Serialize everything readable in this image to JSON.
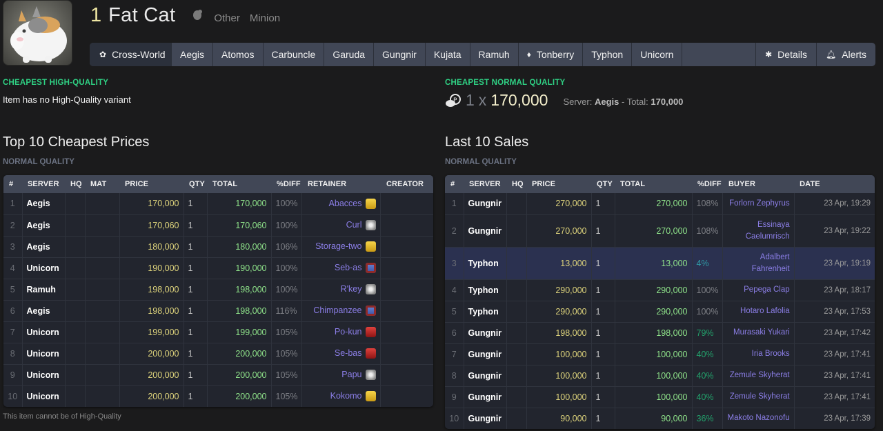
{
  "item": {
    "level": "1",
    "name": "Fat Cat",
    "category_icon": "minion-icon",
    "category_labels": [
      "Other",
      "Minion"
    ]
  },
  "tabs": [
    {
      "label": "Cross-World",
      "icon": "cross-world-icon"
    },
    {
      "label": "Aegis"
    },
    {
      "label": "Atomos"
    },
    {
      "label": "Carbuncle"
    },
    {
      "label": "Garuda"
    },
    {
      "label": "Gungnir"
    },
    {
      "label": "Kujata"
    },
    {
      "label": "Ramuh"
    },
    {
      "label": "Tonberry",
      "icon": "home-server-icon"
    },
    {
      "label": "Typhon"
    },
    {
      "label": "Unicorn"
    }
  ],
  "tabs_right": [
    {
      "label": "Details",
      "icon": "details-icon"
    },
    {
      "label": "Alerts",
      "icon": "alerts-icon"
    }
  ],
  "cheapest_hq": {
    "label": "CHEAPEST HIGH-QUALITY",
    "text": "Item has no High-Quality variant"
  },
  "cheapest_nq": {
    "label": "CHEAPEST NORMAL QUALITY",
    "qty": "1",
    "x": "x",
    "price": "170,000",
    "server_label": "Server:",
    "server": "Aegis",
    "total_label": "- Total:",
    "total": "170,000"
  },
  "prices": {
    "title": "Top 10 Cheapest Prices",
    "subtitle": "NORMAL QUALITY",
    "columns": [
      "#",
      "SERVER",
      "HQ",
      "MAT",
      "PRICE",
      "QTY",
      "TOTAL",
      "%DIFF",
      "RETAINER",
      "CREATOR"
    ],
    "rows": [
      {
        "n": "1",
        "server": "Aegis",
        "hq": "",
        "mat": "",
        "price": "170,000",
        "qty": "1",
        "total": "170,000",
        "diff": "100%",
        "retainer": "Abacces",
        "city": "gold",
        "creator": ""
      },
      {
        "n": "2",
        "server": "Aegis",
        "hq": "",
        "mat": "",
        "price": "170,060",
        "qty": "1",
        "total": "170,060",
        "diff": "100%",
        "retainer": "Curl",
        "city": "silver",
        "creator": ""
      },
      {
        "n": "3",
        "server": "Aegis",
        "hq": "",
        "mat": "",
        "price": "180,000",
        "qty": "1",
        "total": "180,000",
        "diff": "106%",
        "retainer": "Storage-two",
        "city": "gold",
        "creator": ""
      },
      {
        "n": "4",
        "server": "Unicorn",
        "hq": "",
        "mat": "",
        "price": "190,000",
        "qty": "1",
        "total": "190,000",
        "diff": "100%",
        "retainer": "Seb-as",
        "city": "blue",
        "creator": ""
      },
      {
        "n": "5",
        "server": "Ramuh",
        "hq": "",
        "mat": "",
        "price": "198,000",
        "qty": "1",
        "total": "198,000",
        "diff": "100%",
        "retainer": "R'key",
        "city": "silver",
        "creator": ""
      },
      {
        "n": "6",
        "server": "Aegis",
        "hq": "",
        "mat": "",
        "price": "198,000",
        "qty": "1",
        "total": "198,000",
        "diff": "116%",
        "retainer": "Chimpanzee",
        "city": "blue",
        "creator": ""
      },
      {
        "n": "7",
        "server": "Unicorn",
        "hq": "",
        "mat": "",
        "price": "199,000",
        "qty": "1",
        "total": "199,000",
        "diff": "105%",
        "retainer": "Po-kun",
        "city": "red",
        "creator": ""
      },
      {
        "n": "8",
        "server": "Unicorn",
        "hq": "",
        "mat": "",
        "price": "200,000",
        "qty": "1",
        "total": "200,000",
        "diff": "105%",
        "retainer": "Se-bas",
        "city": "red",
        "creator": ""
      },
      {
        "n": "9",
        "server": "Unicorn",
        "hq": "",
        "mat": "",
        "price": "200,000",
        "qty": "1",
        "total": "200,000",
        "diff": "105%",
        "retainer": "Papu",
        "city": "silver",
        "creator": ""
      },
      {
        "n": "10",
        "server": "Unicorn",
        "hq": "",
        "mat": "",
        "price": "200,000",
        "qty": "1",
        "total": "200,000",
        "diff": "105%",
        "retainer": "Kokomo",
        "city": "gold",
        "creator": ""
      }
    ],
    "footnote": "This item cannot be of High-Quality"
  },
  "sales": {
    "title": "Last 10 Sales",
    "subtitle": "NORMAL QUALITY",
    "columns": [
      "#",
      "SERVER",
      "HQ",
      "PRICE",
      "QTY",
      "TOTAL",
      "%DIFF",
      "BUYER",
      "DATE"
    ],
    "rows": [
      {
        "n": "1",
        "server": "Gungnir",
        "hq": "",
        "price": "270,000",
        "qty": "1",
        "total": "270,000",
        "diff": "108%",
        "diff_level": "",
        "buyer": [
          "Forlorn Zephyrus"
        ],
        "date": "23 Apr, 19:29"
      },
      {
        "n": "2",
        "server": "Gungnir",
        "hq": "",
        "price": "270,000",
        "qty": "1",
        "total": "270,000",
        "diff": "108%",
        "diff_level": "",
        "buyer": [
          "Essinaya",
          "Caelumrisch"
        ],
        "date": "23 Apr, 19:22"
      },
      {
        "n": "3",
        "server": "Typhon",
        "hq": "",
        "price": "13,000",
        "qty": "1",
        "total": "13,000",
        "diff": "4%",
        "diff_level": "vlow",
        "buyer": [
          "Adalbert",
          "Fahrenheit"
        ],
        "date": "23 Apr, 19:19",
        "highlight": true
      },
      {
        "n": "4",
        "server": "Typhon",
        "hq": "",
        "price": "290,000",
        "qty": "1",
        "total": "290,000",
        "diff": "100%",
        "diff_level": "",
        "buyer": [
          "Pepega Clap"
        ],
        "date": "23 Apr, 18:17"
      },
      {
        "n": "5",
        "server": "Typhon",
        "hq": "",
        "price": "290,000",
        "qty": "1",
        "total": "290,000",
        "diff": "100%",
        "diff_level": "",
        "buyer": [
          "Hotaro Lafolia"
        ],
        "date": "23 Apr, 17:53"
      },
      {
        "n": "6",
        "server": "Gungnir",
        "hq": "",
        "price": "198,000",
        "qty": "1",
        "total": "198,000",
        "diff": "79%",
        "diff_level": "low",
        "buyer": [
          "Murasaki Yukari"
        ],
        "date": "23 Apr, 17:42"
      },
      {
        "n": "7",
        "server": "Gungnir",
        "hq": "",
        "price": "100,000",
        "qty": "1",
        "total": "100,000",
        "diff": "40%",
        "diff_level": "low",
        "buyer": [
          "Iria Brooks"
        ],
        "date": "23 Apr, 17:41"
      },
      {
        "n": "8",
        "server": "Gungnir",
        "hq": "",
        "price": "100,000",
        "qty": "1",
        "total": "100,000",
        "diff": "40%",
        "diff_level": "low",
        "buyer": [
          "Zemule Skyherat"
        ],
        "date": "23 Apr, 17:41"
      },
      {
        "n": "9",
        "server": "Gungnir",
        "hq": "",
        "price": "100,000",
        "qty": "1",
        "total": "100,000",
        "diff": "40%",
        "diff_level": "low",
        "buyer": [
          "Zemule Skyherat"
        ],
        "date": "23 Apr, 17:41"
      },
      {
        "n": "10",
        "server": "Gungnir",
        "hq": "",
        "price": "90,000",
        "qty": "1",
        "total": "90,000",
        "diff": "36%",
        "diff_level": "low",
        "buyer": [
          "Makoto Nazonofu"
        ],
        "date": "23 Apr, 17:39"
      }
    ]
  },
  "colors": {
    "accent_green": "#2fd184",
    "price_yellow": "#dcd27b",
    "total_green": "#8fe38a",
    "name_purple": "#8b7ee6",
    "tab_bg": "#414756"
  }
}
